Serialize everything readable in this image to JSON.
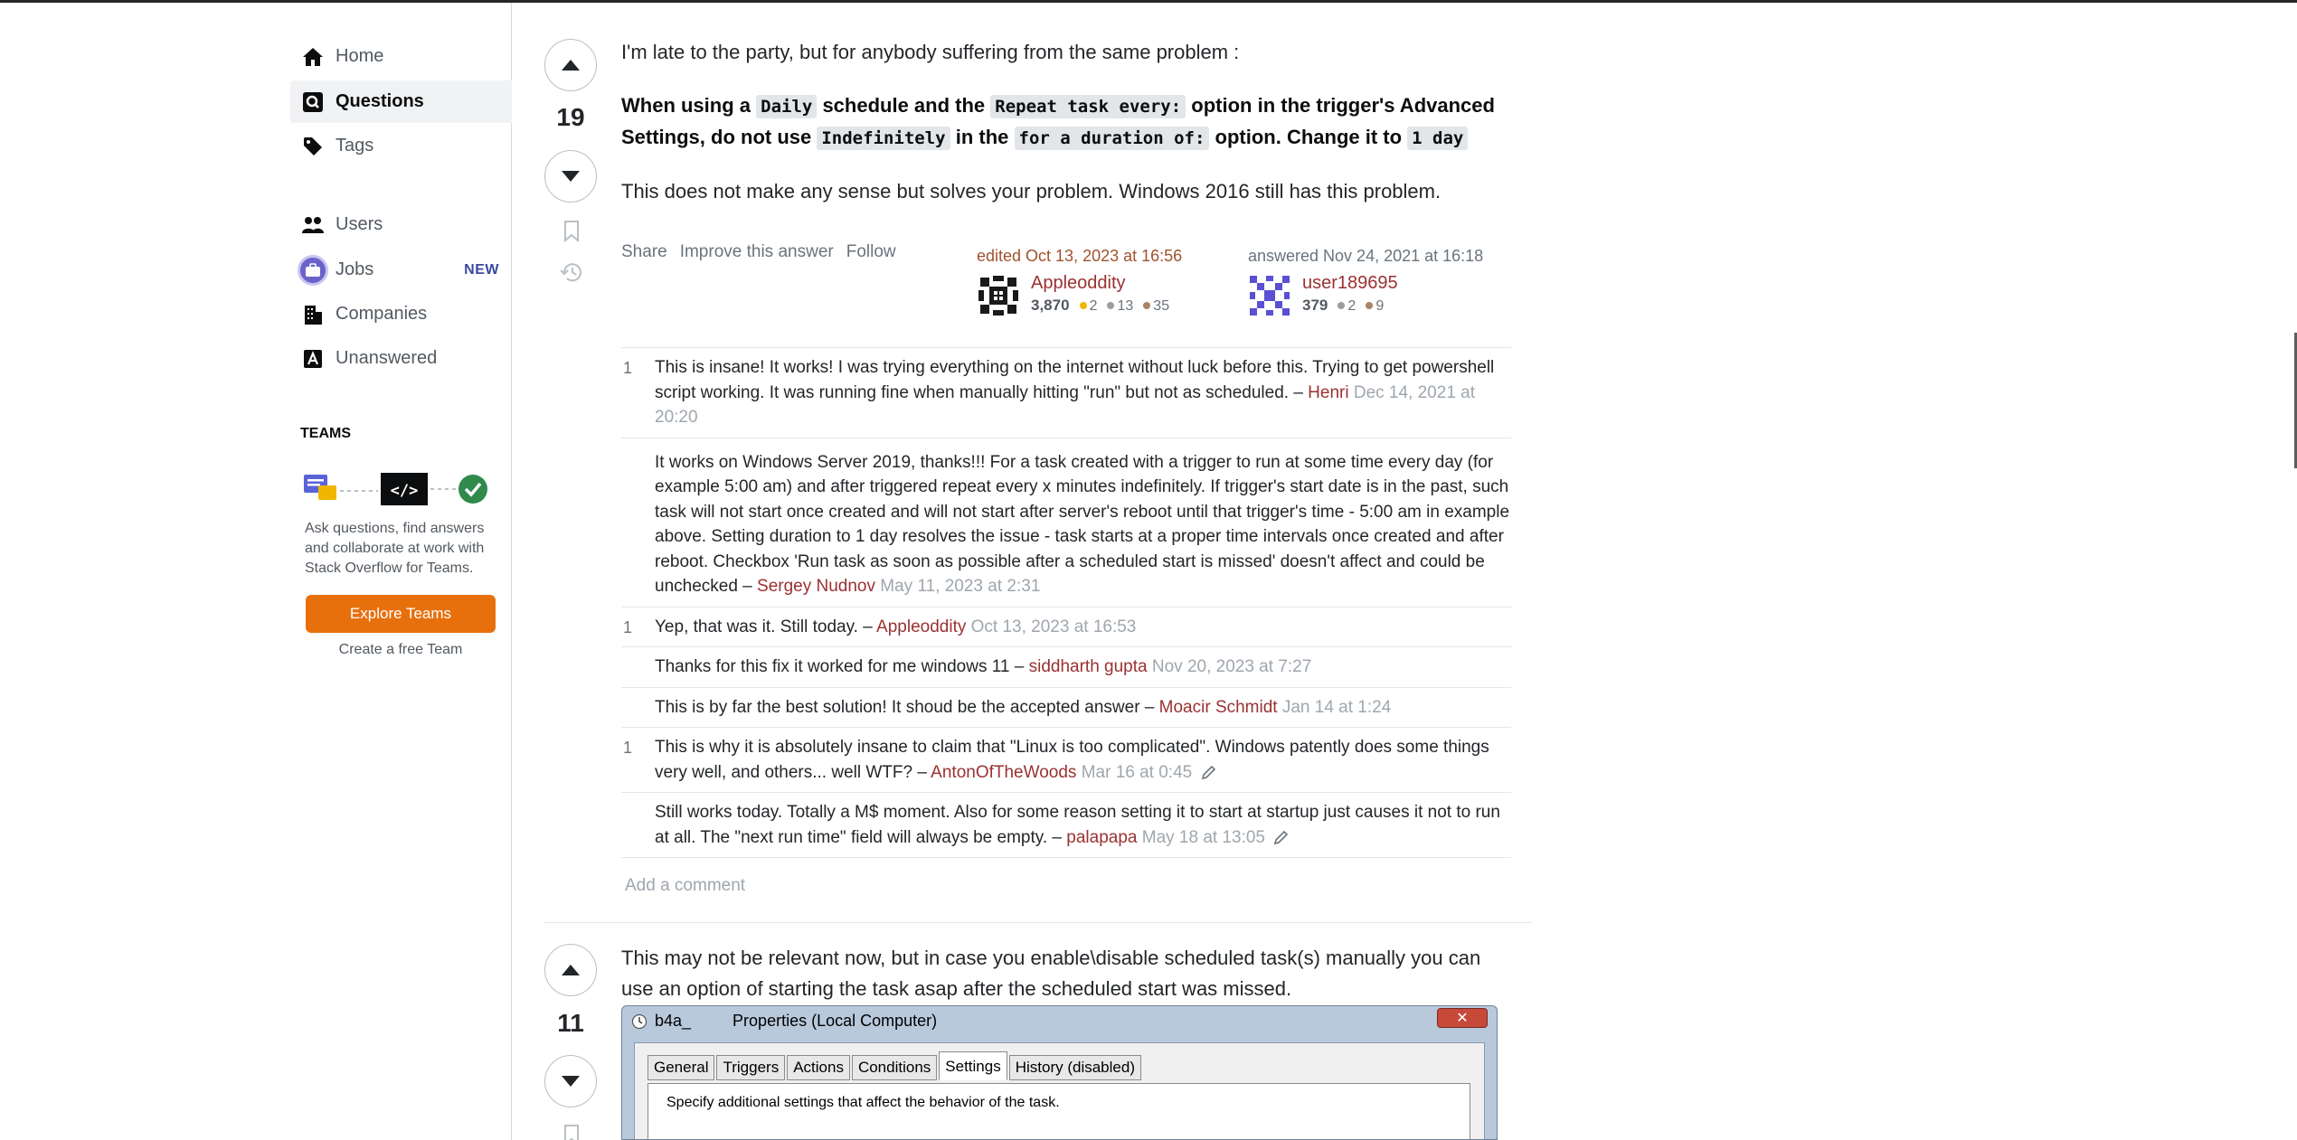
{
  "nav": {
    "home": "Home",
    "questions": "Questions",
    "tags": "Tags",
    "users": "Users",
    "jobs": "Jobs",
    "jobs_badge": "NEW",
    "companies": "Companies",
    "unanswered": "Unanswered"
  },
  "teams": {
    "title": "TEAMS",
    "description": "Ask questions, find answers and collaborate at work with Stack Overflow for Teams.",
    "explore_button": "Explore Teams",
    "create_link": "Create a free Team"
  },
  "answer1": {
    "votes": "19",
    "intro": "I'm late to the party, but for anybody suffering from the same problem :",
    "bold": {
      "p1": "When using a ",
      "c1": "Daily",
      "p2": " schedule and the ",
      "c2": "Repeat task every:",
      "p3": " option in the trigger's Advanced Settings, do not use ",
      "c3": "Indefinitely",
      "p4": " in the ",
      "c4": "for a duration of:",
      "p5": " option. Change it to ",
      "c5": "1 day"
    },
    "note": "This does not make any sense but solves your problem. Windows 2016 still has this problem.",
    "menu": {
      "share": "Share",
      "improve": "Improve this answer",
      "follow": "Follow"
    },
    "edited": {
      "label": "edited Oct 13, 2023 at 16:56",
      "user": "Appleoddity",
      "rep": "3,870",
      "gold": "2",
      "silver": "13",
      "bronze": "35"
    },
    "answered": {
      "label": "answered Nov 24, 2021 at 16:18",
      "user": "user189695",
      "rep": "379",
      "silver": "2",
      "bronze": "9"
    },
    "comments": [
      {
        "score": "1",
        "text": "This is insane! It works! I was trying everything on the internet without luck before this. Trying to get powershell script working. It was running fine when manually hitting \"run\" but not as scheduled.",
        "sep": " – ",
        "user": "Henri",
        "date": " Dec 14, 2021 at 20:20"
      },
      {
        "score": "",
        "text": "It works on Windows Server 2019, thanks!!! For a task created with a trigger to run at some time every day (for example 5:00 am) and after triggered repeat every x minutes indefinitely. If trigger's start date is in the past, such task will not start once created and will not start after server's reboot until that trigger's time - 5:00 am in example above. Setting duration to 1 day resolves the issue - task starts at a proper time intervals once created and after reboot. Checkbox 'Run task as soon as possible after a scheduled start is missed' doesn't affect and could be unchecked",
        "sep": " – ",
        "user": "Sergey Nudnov",
        "date": " May 11, 2023 at 2:31"
      },
      {
        "score": "1",
        "text": "Yep, that was it. Still today.",
        "sep": " – ",
        "user": "Appleoddity",
        "date": " Oct 13, 2023 at 16:53"
      },
      {
        "score": "",
        "text": "Thanks for this fix it worked for me windows 11",
        "sep": " – ",
        "user": "siddharth gupta",
        "date": " Nov 20, 2023 at 7:27"
      },
      {
        "score": "",
        "text": "This is by far the best solution! It shoud be the accepted answer",
        "sep": " – ",
        "user": "Moacir Schmidt",
        "date": " Jan 14 at 1:24"
      },
      {
        "score": "1",
        "text": "This is why it is absolutely insane to claim that \"Linux is too complicated\". Windows patently does some things very well, and others... well WTF?",
        "sep": " – ",
        "user": "AntonOfTheWoods",
        "date": " Mar 16 at 0:45"
      },
      {
        "score": "",
        "text": "Still works today. Totally a M$ moment. Also for some reason setting it to start at startup just causes it not to run at all. The \"next run time\" field will always be empty.",
        "sep": " – ",
        "user": "palapapa",
        "date": " May 18 at 13:05"
      }
    ],
    "add_comment": "Add a comment"
  },
  "answer2": {
    "votes": "11",
    "text": "This may not be relevant now, but in case you enable\\disable scheduled task(s) manually you can use an option of starting the task asap after the scheduled start was missed.",
    "window": {
      "name": "b4a_",
      "title": "Properties (Local Computer)",
      "tabs": [
        "General",
        "Triggers",
        "Actions",
        "Conditions",
        "Settings",
        "History (disabled)"
      ],
      "description": "Specify additional settings that affect the behavior of the task."
    }
  },
  "colors": {
    "accent": "#e7700d",
    "link": "#9a3131",
    "jobs": "#6b62c9"
  }
}
